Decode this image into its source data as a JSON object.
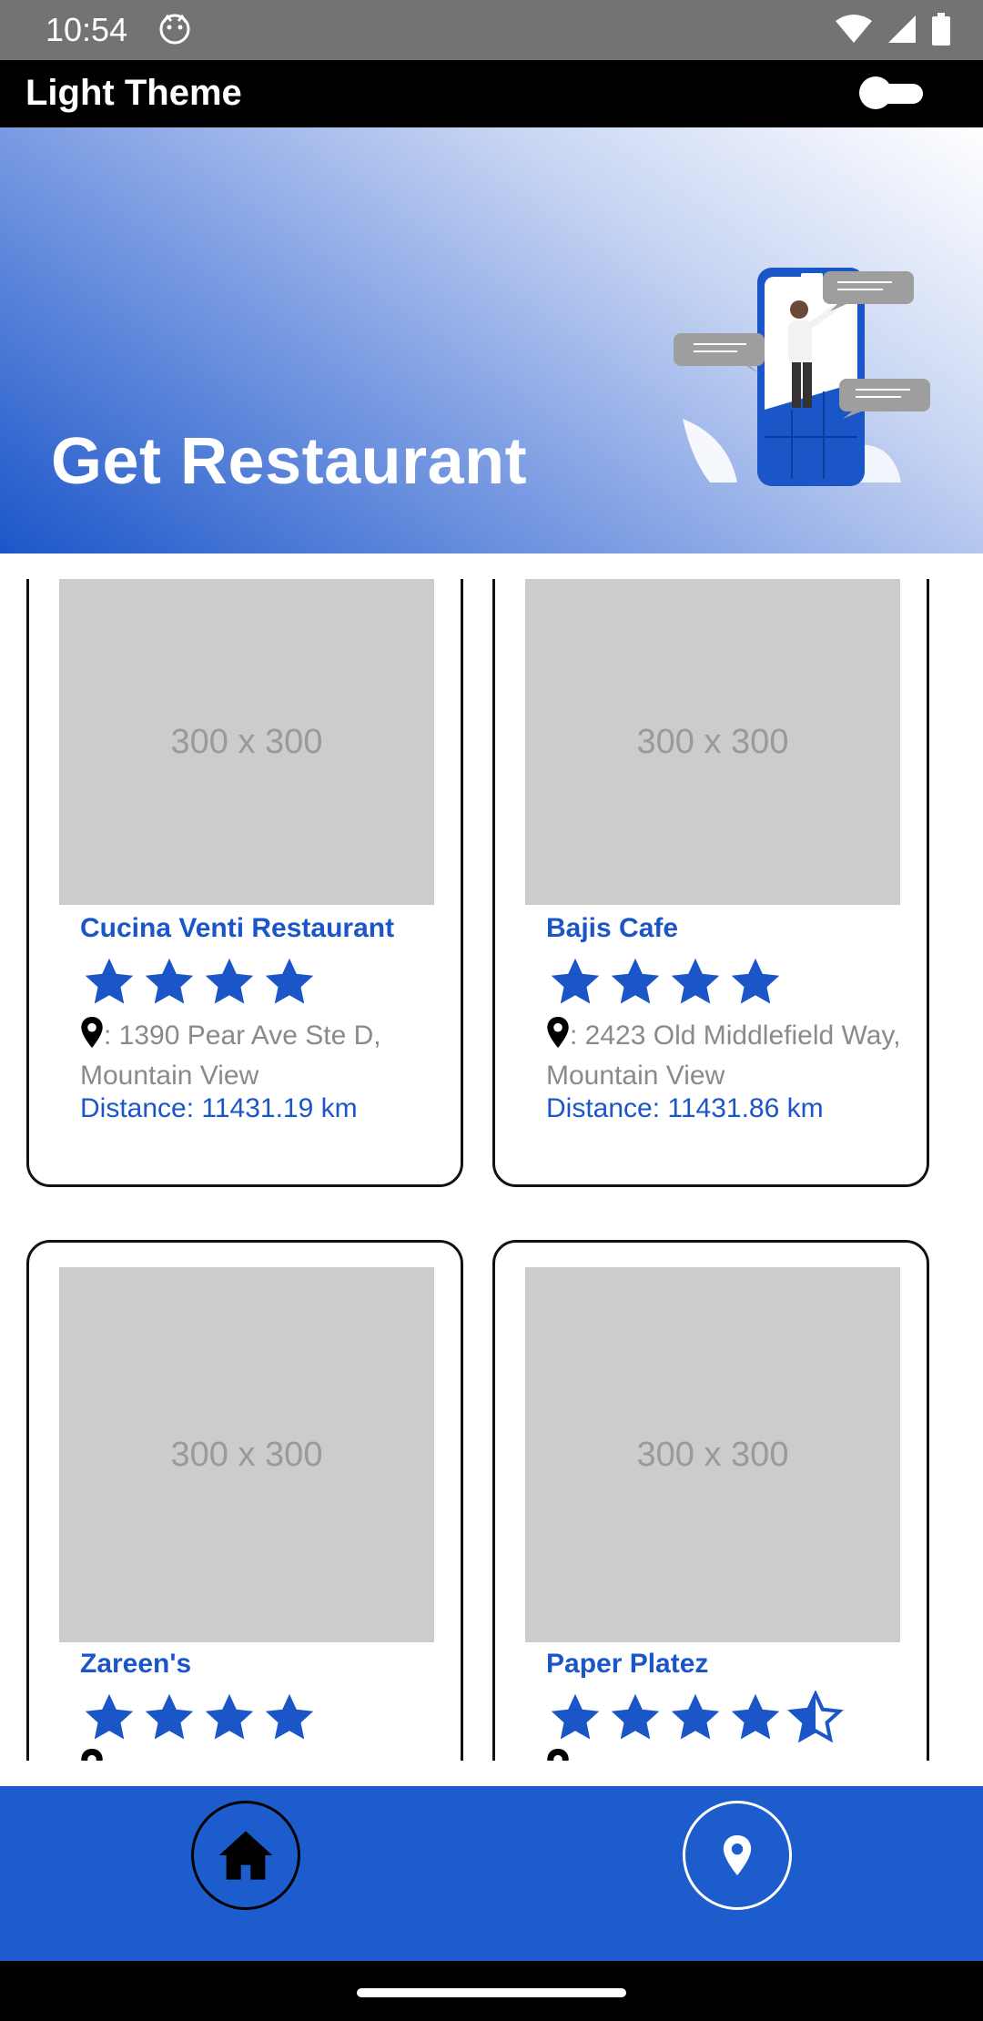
{
  "status_bar": {
    "time": "10:54",
    "icons": [
      "emoji-face-icon",
      "wifi-icon",
      "cell-signal-icon",
      "battery-icon"
    ]
  },
  "app_bar": {
    "title": "Light Theme",
    "theme_toggle_on": false
  },
  "hero": {
    "title": "Get Restaurant",
    "illustration": "phone-chat-illustration"
  },
  "restaurants": [
    {
      "name": "Cucina Venti Restaurant",
      "image_placeholder": "300 x 300",
      "rating": 4,
      "address": ": 1390 Pear Ave Ste D, Mountain View",
      "distance": "Distance: 11431.19 km"
    },
    {
      "name": "Bajis Cafe",
      "image_placeholder": "300 x 300",
      "rating": 4,
      "address": ": 2423 Old Middlefield Way, Mountain View",
      "distance": "Distance: 11431.86 km"
    },
    {
      "name": "Zareen's",
      "image_placeholder": "300 x 300",
      "rating": 4
    },
    {
      "name": "Paper Platez",
      "image_placeholder": "300 x 300",
      "rating": 4.5
    }
  ],
  "bottom_nav": {
    "items": [
      {
        "icon": "home-icon",
        "active": true
      },
      {
        "icon": "location-pin-icon",
        "active": false
      }
    ]
  },
  "colors": {
    "accent": "#1b56c9",
    "nav_background": "#1d5ccc",
    "placeholder_gray": "#cccccc",
    "address_gray": "#8a8a8a"
  }
}
